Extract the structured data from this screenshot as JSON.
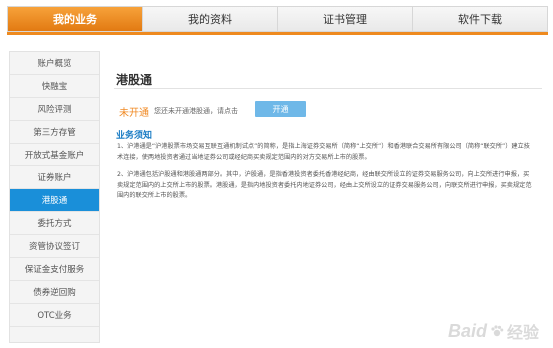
{
  "topnav": {
    "tabs": [
      {
        "label": "我的业务"
      },
      {
        "label": "我的资料"
      },
      {
        "label": "证书管理"
      },
      {
        "label": "软件下载"
      }
    ]
  },
  "sidebar": {
    "items": [
      {
        "label": "账户概览"
      },
      {
        "label": "快融宝"
      },
      {
        "label": "风险评测"
      },
      {
        "label": "第三方存管"
      },
      {
        "label": "开放式基金账户"
      },
      {
        "label": "证券账户"
      },
      {
        "label": "港股通"
      },
      {
        "label": "委托方式"
      },
      {
        "label": "资管协议签订"
      },
      {
        "label": "保证金支付服务"
      },
      {
        "label": "债券逆回购"
      },
      {
        "label": "OTC业务"
      }
    ]
  },
  "main": {
    "title": "港股通",
    "status": "未开通",
    "status_note": "您还未开通港股通，请点击",
    "open_button": "开通",
    "notice_heading": "业务须知",
    "para1": "1、沪港通是“沪港股票市场交易互联互通机制试点”的简称，是指上海证券交易所（简称“上交所”）和香港联合交易所有限公司（简称“联交所”）建立技术连接，使两地投资者通过当地证券公司或经纪商买卖规定范围内的对方交易所上市的股票。",
    "para2": "2、沪港通包括沪股通和港股通两部分。其中，沪股通，是指香港投资者委托香港经纪商，经由联交所设立的证券交易服务公司，向上交所进行申报，买卖规定范围内的上交所上市的股票。港股通，是指内地投资者委托内地证券公司，经由上交所设立的证券交易服务公司，向联交所进行申报，买卖规定范围内的联交所上市的股票。"
  },
  "watermark": {
    "logo": "Baid",
    "suffix": "经验"
  },
  "colors": {
    "accent_orange": "#ee8a1f",
    "active_blue": "#1a8fd9",
    "button_blue": "#6fb8e8"
  }
}
